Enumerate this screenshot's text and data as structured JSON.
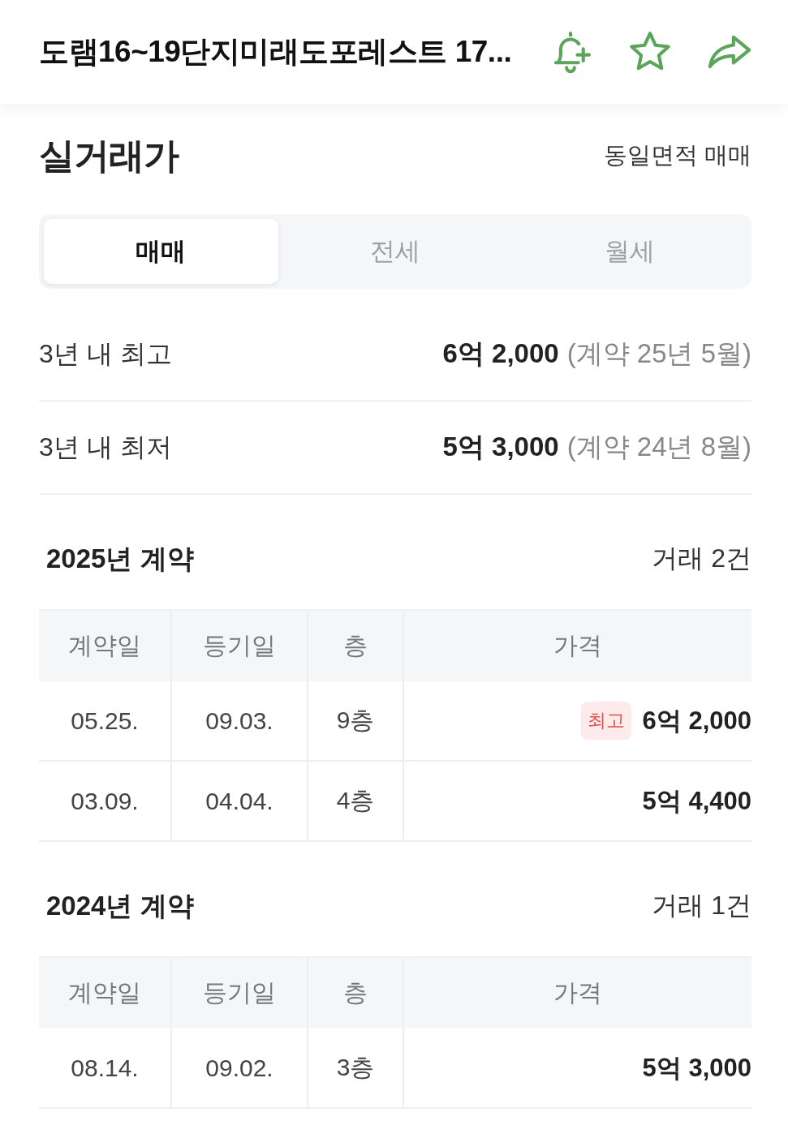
{
  "header": {
    "title": "도램16~19단지미래도포레스트 17..."
  },
  "section": {
    "title": "실거래가",
    "filter": "동일면적 매매"
  },
  "tabs": [
    {
      "label": "매매",
      "selected": true
    },
    {
      "label": "전세",
      "selected": false
    },
    {
      "label": "월세",
      "selected": false
    }
  ],
  "summary": [
    {
      "label": "3년 내 최고",
      "price": "6억 2,000",
      "note": "(계약 25년 5월)"
    },
    {
      "label": "3년 내 최저",
      "price": "5억 3,000",
      "note": "(계약 24년 8월)"
    }
  ],
  "groups": [
    {
      "title": "2025년 계약",
      "count": "거래 2건",
      "columns": [
        "계약일",
        "등기일",
        "층",
        "가격"
      ],
      "rows": [
        {
          "contract_date": "05.25.",
          "registration_date": "09.03.",
          "floor": "9층",
          "badge": "최고",
          "price": "6억 2,000"
        },
        {
          "contract_date": "03.09.",
          "registration_date": "04.04.",
          "floor": "4층",
          "price": "5억 4,400"
        }
      ]
    },
    {
      "title": "2024년 계약",
      "count": "거래 1건",
      "columns": [
        "계약일",
        "등기일",
        "층",
        "가격"
      ],
      "rows": [
        {
          "contract_date": "08.14.",
          "registration_date": "09.02.",
          "floor": "3층",
          "price": "5억 3,000"
        }
      ]
    }
  ]
}
